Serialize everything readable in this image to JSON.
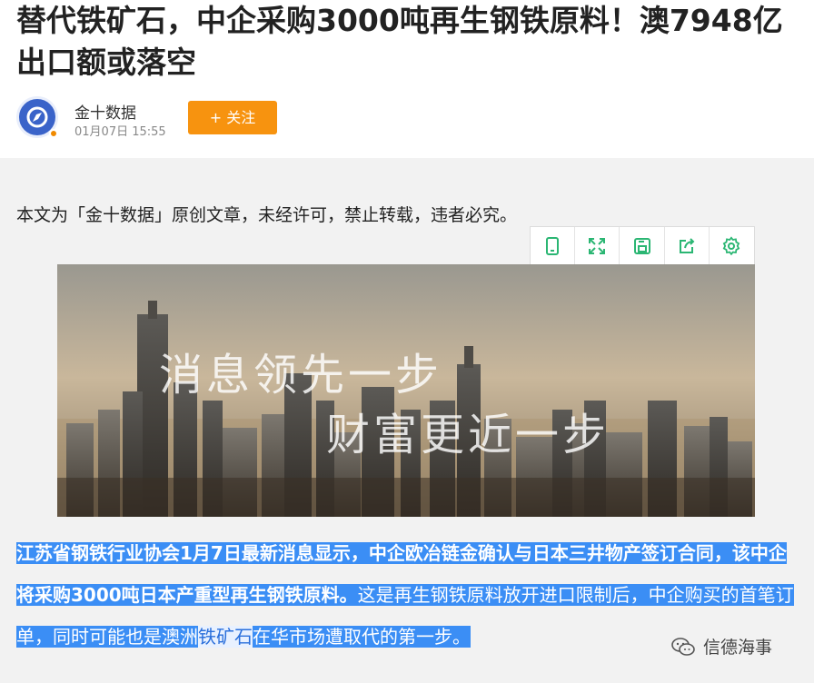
{
  "article": {
    "title": "替代铁矿石，中企采购3000吨再生钢铁原料！澳7948亿出口额或落空",
    "author_name": "金十数据",
    "publish_time": "01月07日  15:55",
    "follow_label": "+ 关注",
    "notice": "本文为「金十数据」原创文章，未经许可，禁止转载，违者必究。",
    "banner_slogan_1": "消息领先一步",
    "banner_slogan_2": "财富更近一步",
    "paragraph": {
      "bold_part": "江苏省钢铁行业协会1月7日最新消息显示，中企欧冶链金确认与日本三井物产签订合同，该中企将采购3000吨日本产重型再生钢铁原料。",
      "normal_part_1": "这是再生钢铁原料放开进口限制后，中企购买的首笔订单，同时可能也是澳洲",
      "link_text": "铁矿石",
      "normal_part_2": "在华市场遭取代的第一步。"
    }
  },
  "toolbar": {
    "items": [
      {
        "icon": "tablet-icon"
      },
      {
        "icon": "fullscreen-icon"
      },
      {
        "icon": "save-icon"
      },
      {
        "icon": "share-icon"
      },
      {
        "icon": "settings-icon"
      }
    ],
    "icon_color": "#2bb673"
  },
  "watermark": {
    "text": "信德海事"
  },
  "colors": {
    "follow_button": "#f7930f",
    "highlight": "#3b8ef5",
    "avatar": "#3a63c9"
  }
}
